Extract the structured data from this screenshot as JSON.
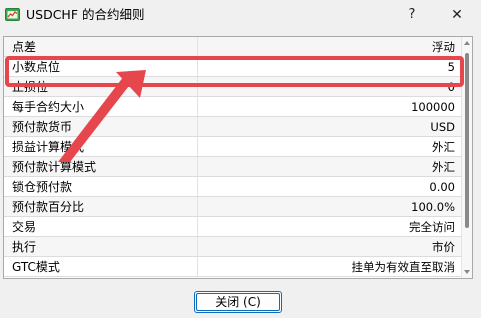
{
  "window": {
    "title": "USDCHF 的合约细则",
    "help_label": "?",
    "close_label": "✕"
  },
  "specs": [
    {
      "label": "点差",
      "value": "浮动"
    },
    {
      "label": "小数点位",
      "value": "5"
    },
    {
      "label": "止损位",
      "value": "0"
    },
    {
      "label": "每手合约大小",
      "value": "100000"
    },
    {
      "label": "预付款货币",
      "value": "USD"
    },
    {
      "label": "损益计算模式",
      "value": "外汇"
    },
    {
      "label": "预付款计算模式",
      "value": "外汇"
    },
    {
      "label": "锁仓预付款",
      "value": "0.00"
    },
    {
      "label": "预付款百分比",
      "value": "100.0%"
    },
    {
      "label": "交易",
      "value": "完全访问"
    },
    {
      "label": "执行",
      "value": "市价"
    },
    {
      "label": "GTC模式",
      "value": "挂单为有效直至取消"
    }
  ],
  "footer": {
    "close_button_label": "关闭 (C)"
  },
  "colors": {
    "annotation_red": "#e5474c",
    "button_border": "#0f6cbd"
  },
  "icons": {
    "app": "chart-window-icon",
    "help": "question-mark-icon",
    "close": "close-icon"
  }
}
